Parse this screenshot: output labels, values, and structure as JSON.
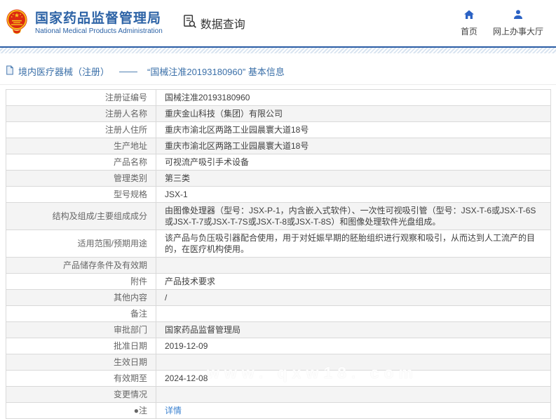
{
  "header": {
    "org_name_cn": "国家药品监督管理局",
    "org_name_en": "National Medical Products Administration",
    "tool_title": "数据查询",
    "nav": [
      {
        "label": "首页",
        "icon": "home-icon"
      },
      {
        "label": "网上办事大厅",
        "icon": "person-icon"
      }
    ]
  },
  "breadcrumb": {
    "category": "境内医疗器械（注册）",
    "separator": "——",
    "detail": "“国械注准20193180960” 基本信息"
  },
  "table": {
    "rows": [
      {
        "label": "注册证编号",
        "value": "国械注准20193180960"
      },
      {
        "label": "注册人名称",
        "value": "重庆金山科技（集团）有限公司"
      },
      {
        "label": "注册人住所",
        "value": "重庆市渝北区两路工业园晨寰大道18号"
      },
      {
        "label": "生产地址",
        "value": "重庆市渝北区两路工业园晨寰大道18号"
      },
      {
        "label": "产品名称",
        "value": "可视流产吸引手术设备"
      },
      {
        "label": "管理类别",
        "value": "第三类"
      },
      {
        "label": "型号规格",
        "value": "JSX-1"
      },
      {
        "label": "结构及组成/主要组成成分",
        "value": "由图像处理器（型号：JSX-P-1，内含嵌入式软件）、一次性可视吸引管（型号：JSX-T-6或JSX-T-6S或JSX-T-7或JSX-T-7S或JSX-T-8或JSX-T-8S）和图像处理软件光盘组成。"
      },
      {
        "label": "适用范围/预期用途",
        "value": "该产品与负压吸引器配合使用，用于对妊娠早期的胚胎组织进行观察和吸引，从而达到人工流产的目的，在医疗机构使用。"
      },
      {
        "label": "产品储存条件及有效期",
        "value": ""
      },
      {
        "label": "附件",
        "value": "产品技术要求"
      },
      {
        "label": "其他内容",
        "value": "/"
      },
      {
        "label": "备注",
        "value": ""
      },
      {
        "label": "审批部门",
        "value": "国家药品监督管理局"
      },
      {
        "label": "批准日期",
        "value": "2019-12-09"
      },
      {
        "label": "生效日期",
        "value": ""
      },
      {
        "label": "有效期至",
        "value": "2024-12-08"
      },
      {
        "label": "变更情况",
        "value": ""
      },
      {
        "label": "●注",
        "value": "详情",
        "link": true
      }
    ]
  },
  "watermark": "www. qxw18. com",
  "colors": {
    "brand_blue": "#2d63a6",
    "icon_blue": "#2b62c4",
    "link_blue": "#3b82d0",
    "row_alt_bg": "#f4f4f4",
    "table_border": "#d9d9d9",
    "header_rule_blue": "#2a5ca4",
    "emblem_red": "#dd2a10",
    "emblem_gold": "#f6c61c"
  }
}
